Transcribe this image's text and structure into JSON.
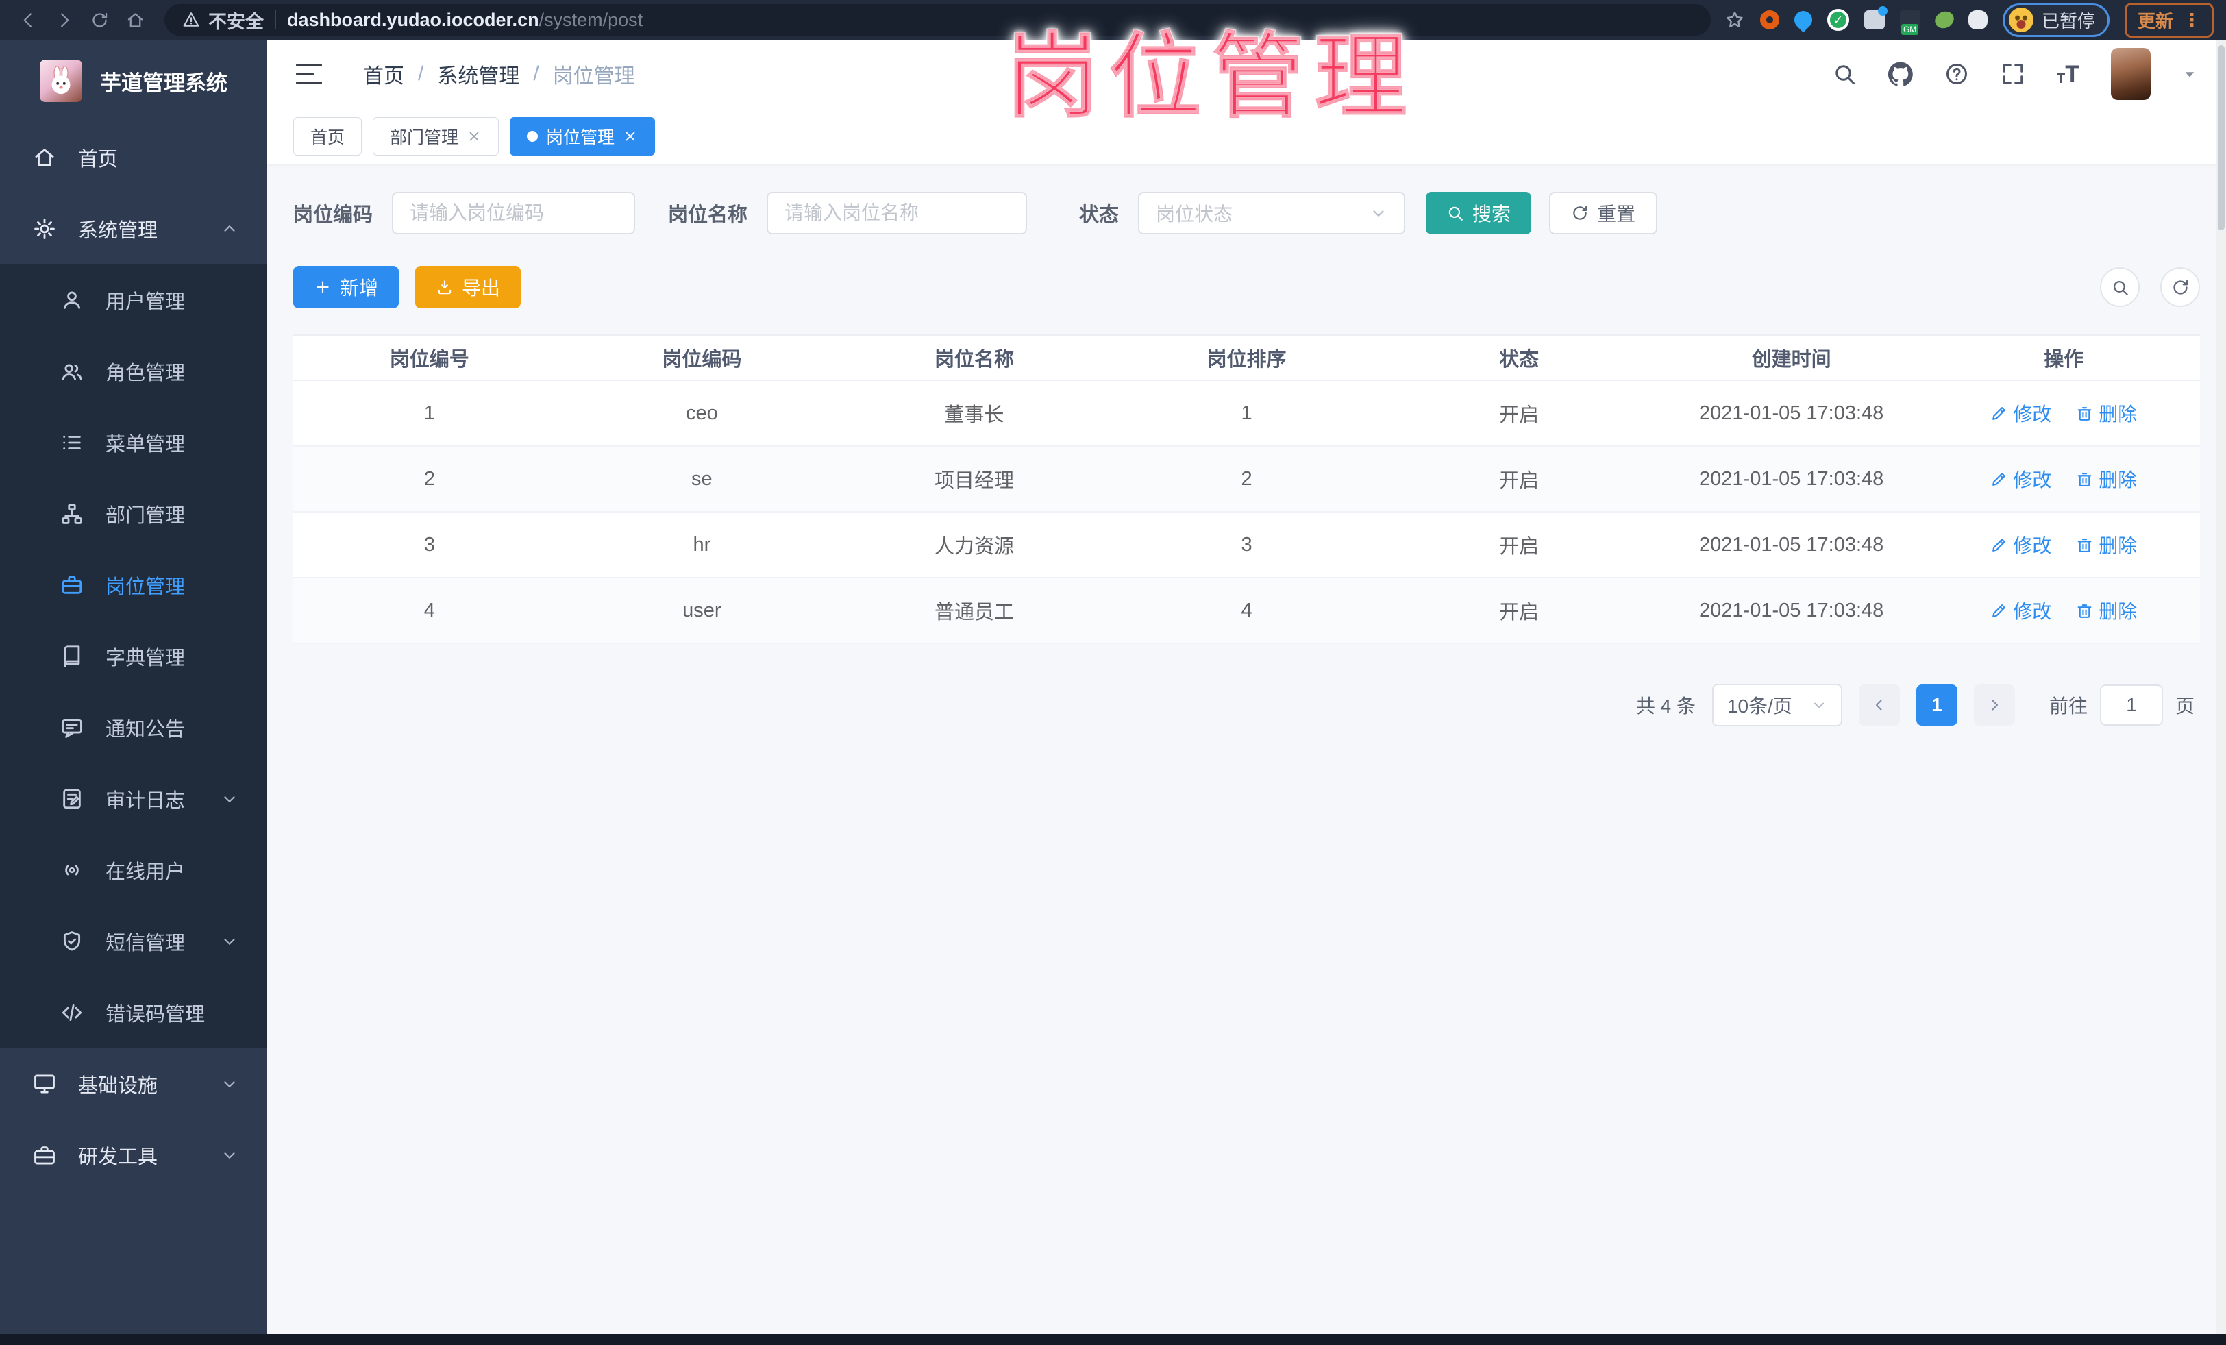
{
  "colors": {
    "accent": "#2d8cf0",
    "teal": "#27a79d",
    "orange": "#f2a30d",
    "pink": "#f43b5f",
    "link": "#2d8cf0"
  },
  "browser": {
    "security_label": "不安全",
    "url_host": "dashboard.yudao.iocoder.cn",
    "url_path": "/system/post",
    "paused_label": "已暂停",
    "update_label": "更新"
  },
  "overlay": {
    "title": "岗位管理"
  },
  "sidebar": {
    "app_title": "芋道管理系统",
    "items": [
      {
        "label": "首页",
        "icon": "home-icon",
        "level": "top"
      },
      {
        "label": "系统管理",
        "icon": "gear-icon",
        "level": "top",
        "arrow": "up"
      },
      {
        "label": "用户管理",
        "icon": "user-icon",
        "level": "sub"
      },
      {
        "label": "角色管理",
        "icon": "users-icon",
        "level": "sub"
      },
      {
        "label": "菜单管理",
        "icon": "menu-list-icon",
        "level": "sub"
      },
      {
        "label": "部门管理",
        "icon": "org-tree-icon",
        "level": "sub"
      },
      {
        "label": "岗位管理",
        "icon": "briefcase-icon",
        "level": "sub",
        "active": true
      },
      {
        "label": "字典管理",
        "icon": "dictionary-icon",
        "level": "sub"
      },
      {
        "label": "通知公告",
        "icon": "announcement-icon",
        "level": "sub"
      },
      {
        "label": "审计日志",
        "icon": "audit-log-icon",
        "level": "sub",
        "arrow": "down"
      },
      {
        "label": "在线用户",
        "icon": "online-user-icon",
        "level": "sub"
      },
      {
        "label": "短信管理",
        "icon": "sms-shield-icon",
        "level": "sub",
        "arrow": "down"
      },
      {
        "label": "错误码管理",
        "icon": "code-icon",
        "level": "sub"
      },
      {
        "label": "基础设施",
        "icon": "infrastructure-icon",
        "level": "top",
        "arrow": "down"
      },
      {
        "label": "研发工具",
        "icon": "devtools-icon",
        "level": "top",
        "arrow": "down"
      }
    ]
  },
  "navbar": {
    "breadcrumb": [
      "首页",
      "系统管理",
      "岗位管理"
    ]
  },
  "tags": [
    {
      "label": "首页",
      "closable": false,
      "active": false
    },
    {
      "label": "部门管理",
      "closable": true,
      "active": false
    },
    {
      "label": "岗位管理",
      "closable": true,
      "active": true
    }
  ],
  "search": {
    "code_label": "岗位编码",
    "code_placeholder": "请输入岗位编码",
    "name_label": "岗位名称",
    "name_placeholder": "请输入岗位名称",
    "status_label": "状态",
    "status_placeholder": "岗位状态",
    "search_button": "搜索",
    "reset_button": "重置"
  },
  "toolbar": {
    "add_button": "新增",
    "export_button": "导出"
  },
  "table": {
    "columns": [
      "岗位编号",
      "岗位编码",
      "岗位名称",
      "岗位排序",
      "状态",
      "创建时间",
      "操作"
    ],
    "rows": [
      {
        "id": "1",
        "code": "ceo",
        "name": "董事长",
        "sort": "1",
        "status": "开启",
        "created": "2021-01-05 17:03:48"
      },
      {
        "id": "2",
        "code": "se",
        "name": "项目经理",
        "sort": "2",
        "status": "开启",
        "created": "2021-01-05 17:03:48"
      },
      {
        "id": "3",
        "code": "hr",
        "name": "人力资源",
        "sort": "3",
        "status": "开启",
        "created": "2021-01-05 17:03:48"
      },
      {
        "id": "4",
        "code": "user",
        "name": "普通员工",
        "sort": "4",
        "status": "开启",
        "created": "2021-01-05 17:03:48"
      }
    ],
    "edit_label": "修改",
    "delete_label": "删除"
  },
  "pagination": {
    "total": "共 4 条",
    "page_size": "10条/页",
    "current_page": "1",
    "goto_label": "前往",
    "goto_value": "1",
    "page_unit": "页"
  }
}
